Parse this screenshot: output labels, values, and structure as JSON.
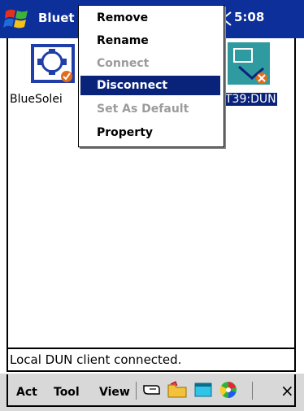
{
  "window": {
    "title": "Bluet",
    "clock": "5:08"
  },
  "devices": [
    {
      "label": "BlueSolei",
      "icon": "bluetooth-service-icon",
      "status": "connected"
    },
    {
      "label": "T39:DUN",
      "icon": "dun-service-icon",
      "status": "selected"
    }
  ],
  "context_menu": {
    "items": [
      {
        "label": "Remove",
        "enabled": true
      },
      {
        "label": "Rename",
        "enabled": true
      },
      {
        "label": "Connect",
        "enabled": false
      },
      {
        "label": "Disconnect",
        "enabled": true,
        "highlighted": true
      },
      {
        "label": "Set As Default",
        "enabled": false
      },
      {
        "label": "Property",
        "enabled": true
      }
    ]
  },
  "status": {
    "text": "Local DUN client connected."
  },
  "menubar": {
    "items": [
      "Act",
      "Tool",
      "View"
    ],
    "toolbar_icons": [
      "pointer-hand-icon",
      "folder-icon",
      "window-icon",
      "color-wheel-icon"
    ],
    "close_label": "×"
  },
  "colors": {
    "titlebar": "#0c2f9a",
    "selection": "#0a237a",
    "disabled_text": "#9c9c9c"
  }
}
